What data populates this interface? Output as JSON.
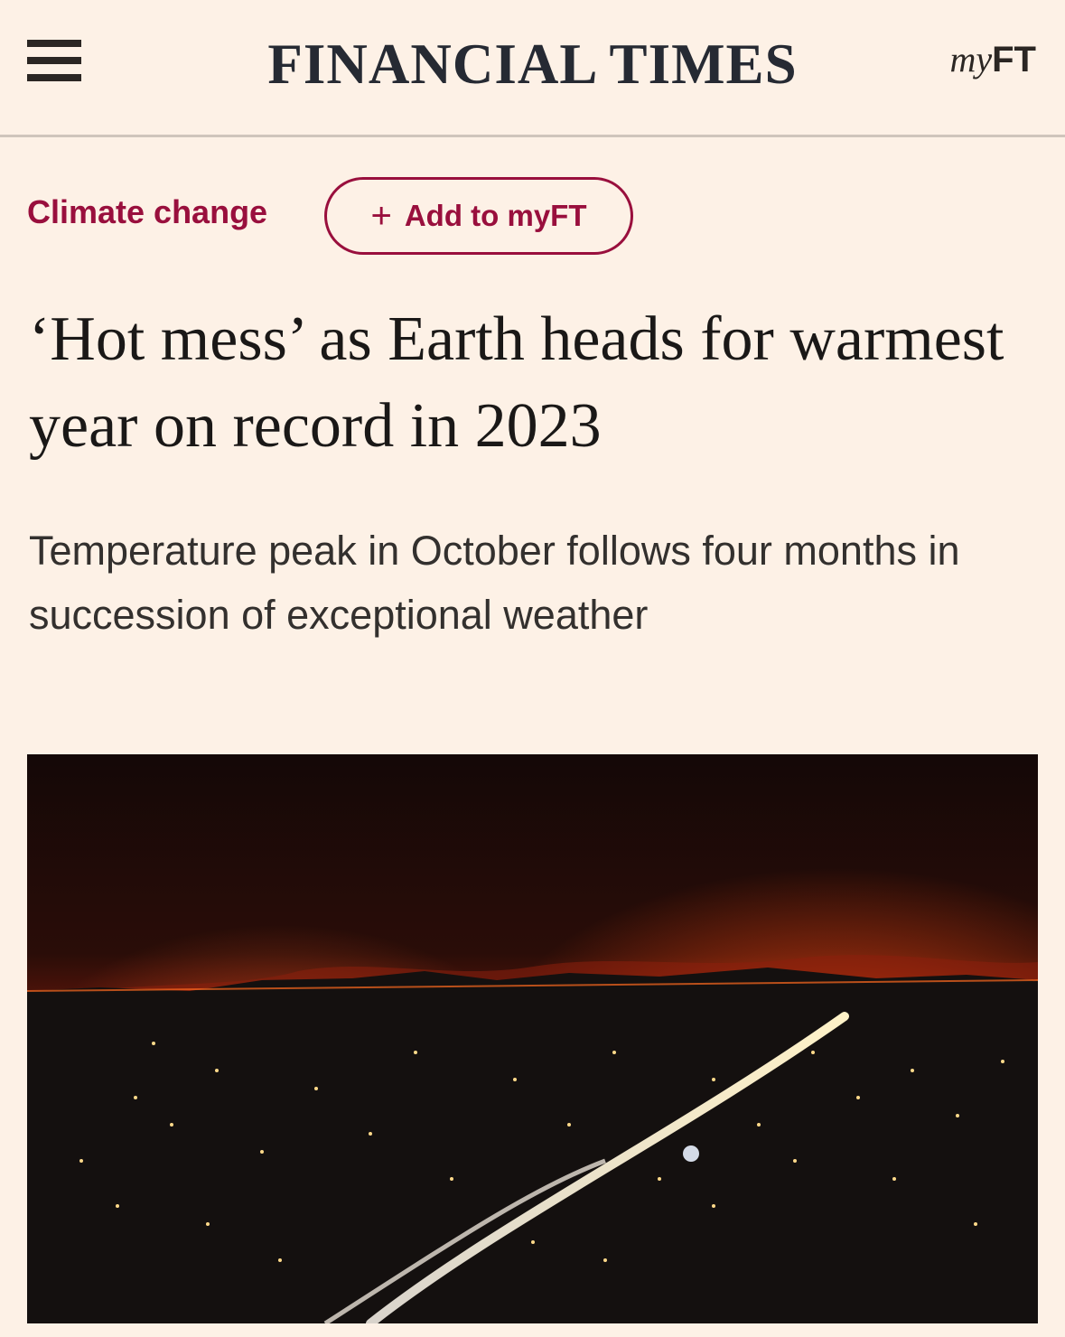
{
  "header": {
    "masthead": "FINANCIAL TIMES",
    "myft_my": "my",
    "myft_ft": "FT",
    "menu_icon": "hamburger-menu-icon"
  },
  "topic": {
    "label": "Climate change",
    "follow_button": {
      "icon": "+",
      "label": "Add to myFT"
    }
  },
  "article": {
    "headline": "‘Hot mess’ as Earth heads for warmest year on record in 2023",
    "standfirst": "Temperature peak in October follows four months in succession of exceptional weather"
  },
  "colors": {
    "background": "#fdf1e6",
    "accent": "#990f3d",
    "text": "#1a1817"
  }
}
